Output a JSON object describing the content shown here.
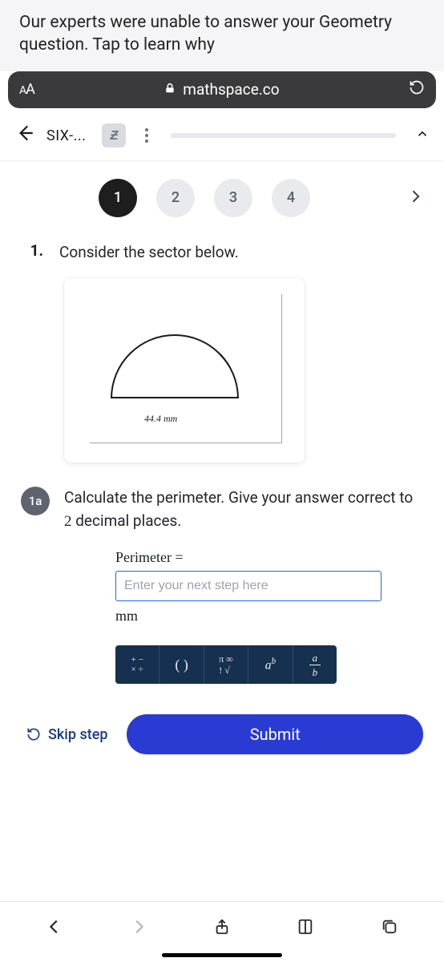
{
  "notice": "Our experts were unable to answer your Geometry question. Tap to learn why",
  "urlbar": {
    "textsize": "AA",
    "domain": "mathspace.co"
  },
  "appbar": {
    "crumb": "SIX-..."
  },
  "qnav": {
    "items": [
      "1",
      "2",
      "3",
      "4"
    ],
    "active_index": 0
  },
  "question": {
    "number": "1.",
    "prompt": "Consider the sector below.",
    "figure": {
      "measure": "44.4 mm"
    }
  },
  "subquestion": {
    "label": "1a",
    "prompt_html": "Calculate the perimeter. Give your answer correct to 2 decimal places.",
    "perimeter_label": "Perimeter =",
    "placeholder": "Enter your next step here",
    "unit": "mm"
  },
  "toolbar": {
    "ops": [
      "+",
      "−",
      "×",
      "÷"
    ],
    "paren": "( )",
    "sym_top": "π ∞",
    "sym_bot": "! √",
    "power_base": "a",
    "power_exp": "b",
    "frac_num": "a",
    "frac_den": "b"
  },
  "actions": {
    "skip": "Skip step",
    "submit": "Submit"
  },
  "colors": {
    "accent": "#2a3bd4",
    "urlbar": "#3a3a3c",
    "tool": "#16314f"
  }
}
